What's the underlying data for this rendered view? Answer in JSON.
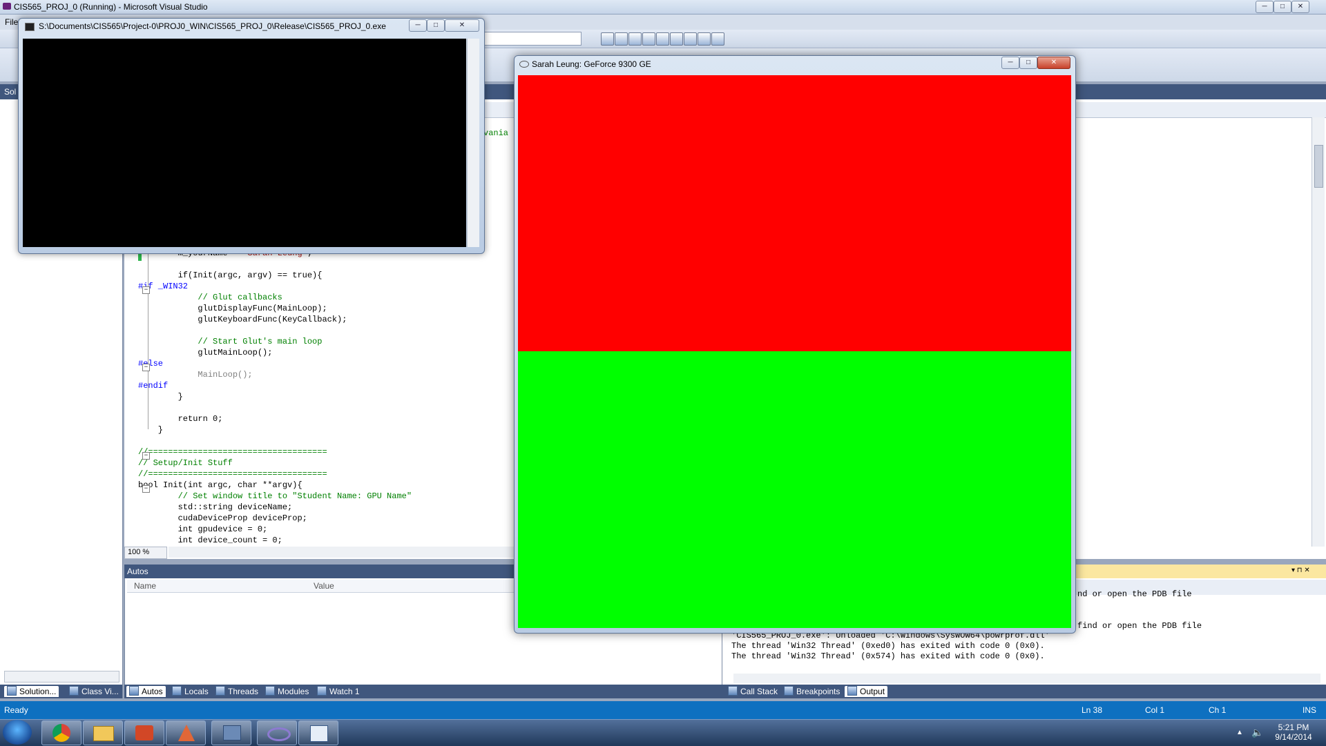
{
  "vs": {
    "title": "CIS565_PROJ_0 (Running) - Microsoft Visual Studio",
    "menu_partial": "File",
    "sol_head": "Sol",
    "zoom": "100 %",
    "autos": {
      "title": "Autos",
      "columns": [
        "Name",
        "Value"
      ]
    },
    "code_partial_right": "vania",
    "code": [
      {
        "text": "        m_yourName = \"Sarah Leung\";",
        "kind": "str"
      },
      {
        "text": "",
        "kind": "plain"
      },
      {
        "text": "        if(Init(argc, argv) == true){",
        "kind": "plain"
      },
      {
        "text": "#if _WIN32",
        "kind": "kw"
      },
      {
        "text": "            // Glut callbacks",
        "kind": "cm"
      },
      {
        "text": "            glutDisplayFunc(MainLoop);",
        "kind": "plain"
      },
      {
        "text": "            glutKeyboardFunc(KeyCallback);",
        "kind": "plain"
      },
      {
        "text": "",
        "kind": "plain"
      },
      {
        "text": "            // Start Glut's main loop",
        "kind": "cm"
      },
      {
        "text": "            glutMainLoop();",
        "kind": "plain"
      },
      {
        "text": "#else",
        "kind": "kw"
      },
      {
        "text": "            MainLoop();",
        "kind": "gr"
      },
      {
        "text": "#endif",
        "kind": "kw"
      },
      {
        "text": "        }",
        "kind": "plain"
      },
      {
        "text": "",
        "kind": "plain"
      },
      {
        "text": "        return 0;",
        "kind": "plain"
      },
      {
        "text": "    }",
        "kind": "plain"
      },
      {
        "text": "",
        "kind": "plain"
      },
      {
        "text": "//====================================",
        "kind": "cm"
      },
      {
        "text": "// Setup/Init Stuff",
        "kind": "cm"
      },
      {
        "text": "//====================================",
        "kind": "cm"
      },
      {
        "text": "bool Init(int argc, char **argv){",
        "kind": "plain"
      },
      {
        "text": "        // Set window title to \"Student Name: GPU Name\"",
        "kind": "cm"
      },
      {
        "text": "        std::string deviceName;",
        "kind": "plain"
      },
      {
        "text": "        cudaDeviceProp deviceProp;",
        "kind": "plain"
      },
      {
        "text": "        int gpudevice = 0;",
        "kind": "plain"
      },
      {
        "text": "        int device_count = 0;",
        "kind": "plain"
      }
    ],
    "output": {
      "lines": [
        "nd or open the PDB file",
        "find or open the PDB file",
        "'CIS565_PROJ_0.exe': Unloaded 'C:\\Windows\\SysWOW64\\powrprof.dll'",
        "The thread 'Win32 Thread' (0xed0) has exited with code 0 (0x0).",
        "The thread 'Win32 Thread' (0x574) has exited with code 0 (0x0)."
      ]
    },
    "left_tabs": [
      "Solution...",
      "Class Vi..."
    ],
    "debug_tabs": [
      "Autos",
      "Locals",
      "Threads",
      "Modules",
      "Watch 1"
    ],
    "output_tabs": [
      "Call Stack",
      "Breakpoints",
      "Output"
    ],
    "status": {
      "ready": "Ready",
      "ln": "Ln 38",
      "col": "Col 1",
      "ch": "Ch 1",
      "ins": "INS"
    }
  },
  "console": {
    "title": "S:\\Documents\\CIS565\\Project-0\\PROJ0_WIN\\CIS565_PROJ_0\\Release\\CIS565_PROJ_0.exe"
  },
  "gl_window": {
    "title": "Sarah Leung: GeForce 9300 GE",
    "top_color": "#ff0000",
    "bottom_color": "#00ff00"
  },
  "taskbar": {
    "time": "5:21 PM",
    "date": "9/14/2014",
    "apps": [
      "chrome-icon",
      "explorer-icon",
      "powerpoint-icon",
      "matlab-icon",
      "network-icon",
      "visual-studio-icon",
      "app-icon"
    ]
  }
}
